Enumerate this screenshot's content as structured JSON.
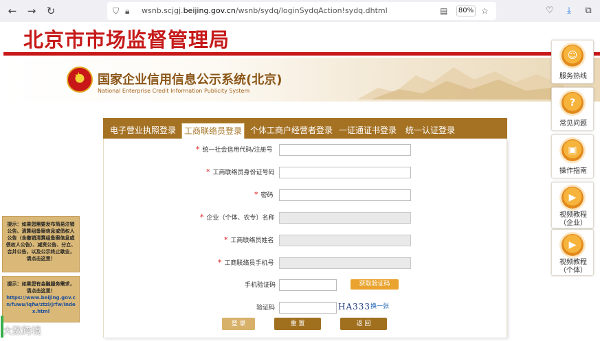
{
  "browser": {
    "url_prefix": "wsnb.scjgj.",
    "url_domain": "beijing.gov.cn",
    "url_path": "/wsnb/sydq/loginSydqAction!sydq.dhtml",
    "zoom": "80%"
  },
  "header": {
    "bureau_title": "北京市市场监督管理局",
    "system_title": "国家企业信用信息公示系统(北京)",
    "system_subtitle": "National Enterprise Credit Information Publicity System"
  },
  "tabs": [
    {
      "label": "电子营业执照登录"
    },
    {
      "label": "工商联络员登录"
    },
    {
      "label": "个体工商户经营者登录"
    },
    {
      "label": "一证通证书登录"
    },
    {
      "label": "统一认证登录"
    }
  ],
  "form": {
    "credit_code_label": "统一社会信用代码/注册号",
    "liaison_id_label": "工商联络员身份证号码",
    "password_label": "密码",
    "company_name_label": "企业（个体、农专）名称",
    "liaison_name_label": "工商联络员姓名",
    "liaison_phone_label": "工商联络员手机号",
    "sms_code_label": "手机验证码",
    "sms_button": "获取验证码",
    "captcha_label": "验证码",
    "captcha_text": "HA333",
    "refresh_link": "换一张",
    "required_mark": "*"
  },
  "actions": {
    "login": "登 录",
    "reset": "重 置",
    "back": "返 回"
  },
  "side_menu": [
    {
      "label": "服务热线"
    },
    {
      "label": "常见问题"
    },
    {
      "label": "操作指南"
    },
    {
      "label": "视频教程\n（企业）"
    },
    {
      "label": "视频教程\n（个体）"
    }
  ],
  "notices": {
    "notice1": "提示：如果您需要发布简易注销公告、清算组备案信息或债权人公告（含撤销清算组备案信息或债权人公告）、减资公告、分立、合并公告，以及公示终止歇业，请点击这里！",
    "notice2": "提示：如果您有金融服务需求，请点击这里！",
    "notice2_link": "https://www.beijing.gov.cn/fuwu/lqfw/ztzl/jrfw/index.html"
  },
  "watermark": "大数跨境"
}
